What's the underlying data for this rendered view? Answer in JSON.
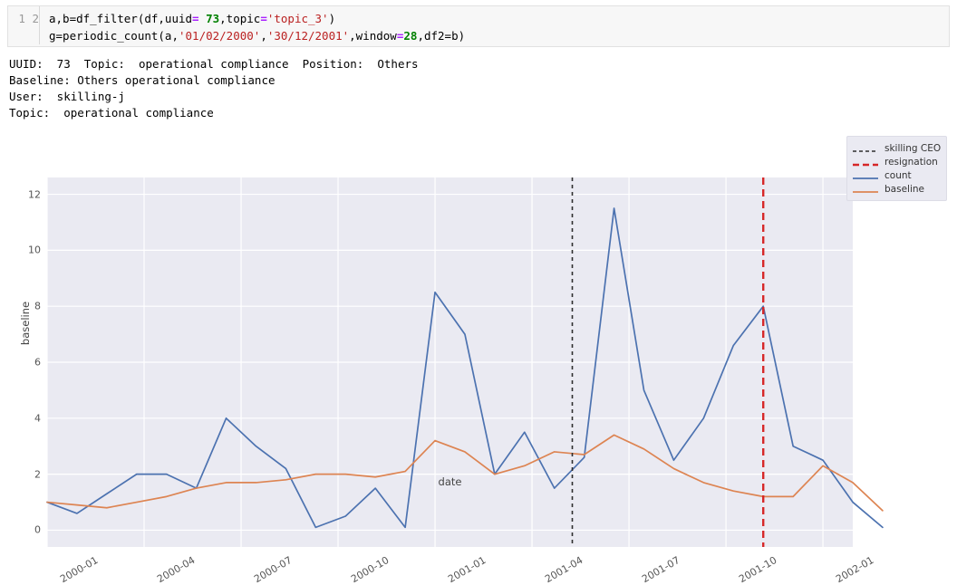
{
  "notebook": {
    "code_cell": {
      "line_numbers": [
        "1",
        "2"
      ],
      "line1": {
        "part1": "a,b=df_filter(df,uuid",
        "eq1": "=",
        "num1": " 73",
        "part2": ",topic",
        "eq2": "=",
        "str1": "'topic_3'",
        "part3": ")"
      },
      "line2": {
        "part1": "g=periodic_count(a,",
        "str1": "'01/02/2000'",
        "part2": ",",
        "str2": "'30/12/2001'",
        "part3": ",window",
        "eq1": "=",
        "num1": "28",
        "part4": ",df2=b)"
      }
    },
    "text_output": {
      "line1": "UUID:  73  Topic:  operational compliance  Position:  Others",
      "line2": "Baseline: Others operational compliance",
      "line3": "User:  skilling-j",
      "line4": "Topic:  operational compliance"
    }
  },
  "legend": {
    "items": [
      {
        "label": "skilling CEO",
        "color": "#2e2e2e",
        "style": "dashed"
      },
      {
        "label": "resignation",
        "color": "#d62728",
        "style": "dashed"
      },
      {
        "label": "count",
        "color": "#4c72b0",
        "style": "solid"
      },
      {
        "label": "baseline",
        "color": "#dd8452",
        "style": "solid"
      }
    ]
  },
  "chart_data": {
    "type": "line",
    "title": "",
    "xlabel": "date",
    "ylabel": "baseline",
    "ylim": [
      -0.6,
      12.6
    ],
    "yticks": [
      0,
      2,
      4,
      6,
      8,
      10,
      12
    ],
    "xticks": [
      "2000-01",
      "2000-04",
      "2000-07",
      "2000-10",
      "2001-01",
      "2001-04",
      "2001-07",
      "2001-10",
      "2002-01"
    ],
    "xtick_index": [
      0,
      3.25,
      6.5,
      9.75,
      13,
      16.25,
      19.5,
      22.75,
      26
    ],
    "grid": true,
    "legend_position": "upper right",
    "x_count": 27,
    "series": [
      {
        "name": "count",
        "color": "#4c72b0",
        "values": [
          1.0,
          0.6,
          1.3,
          2.0,
          2.0,
          1.5,
          4.0,
          3.0,
          2.2,
          0.1,
          0.5,
          1.5,
          0.1,
          8.5,
          7.0,
          2.0,
          3.5,
          1.5,
          2.6,
          11.5,
          5.0,
          2.5,
          4.0,
          6.6,
          8.0,
          3.0,
          2.5,
          1.0,
          0.1
        ]
      },
      {
        "name": "baseline",
        "color": "#dd8452",
        "values": [
          1.0,
          0.9,
          0.8,
          1.0,
          1.2,
          1.5,
          1.7,
          1.7,
          1.8,
          2.0,
          2.0,
          1.9,
          2.1,
          3.2,
          2.8,
          2.0,
          2.3,
          2.8,
          2.7,
          3.4,
          2.9,
          2.2,
          1.7,
          1.4,
          1.2,
          1.2,
          2.3,
          1.7,
          0.7
        ]
      }
    ],
    "vlines": [
      {
        "name": "skilling CEO",
        "x_index": 17.6,
        "color": "#2e2e2e",
        "style": "dashed"
      },
      {
        "name": "resignation",
        "x_index": 24.0,
        "color": "#d62728",
        "style": "dashed"
      }
    ]
  }
}
